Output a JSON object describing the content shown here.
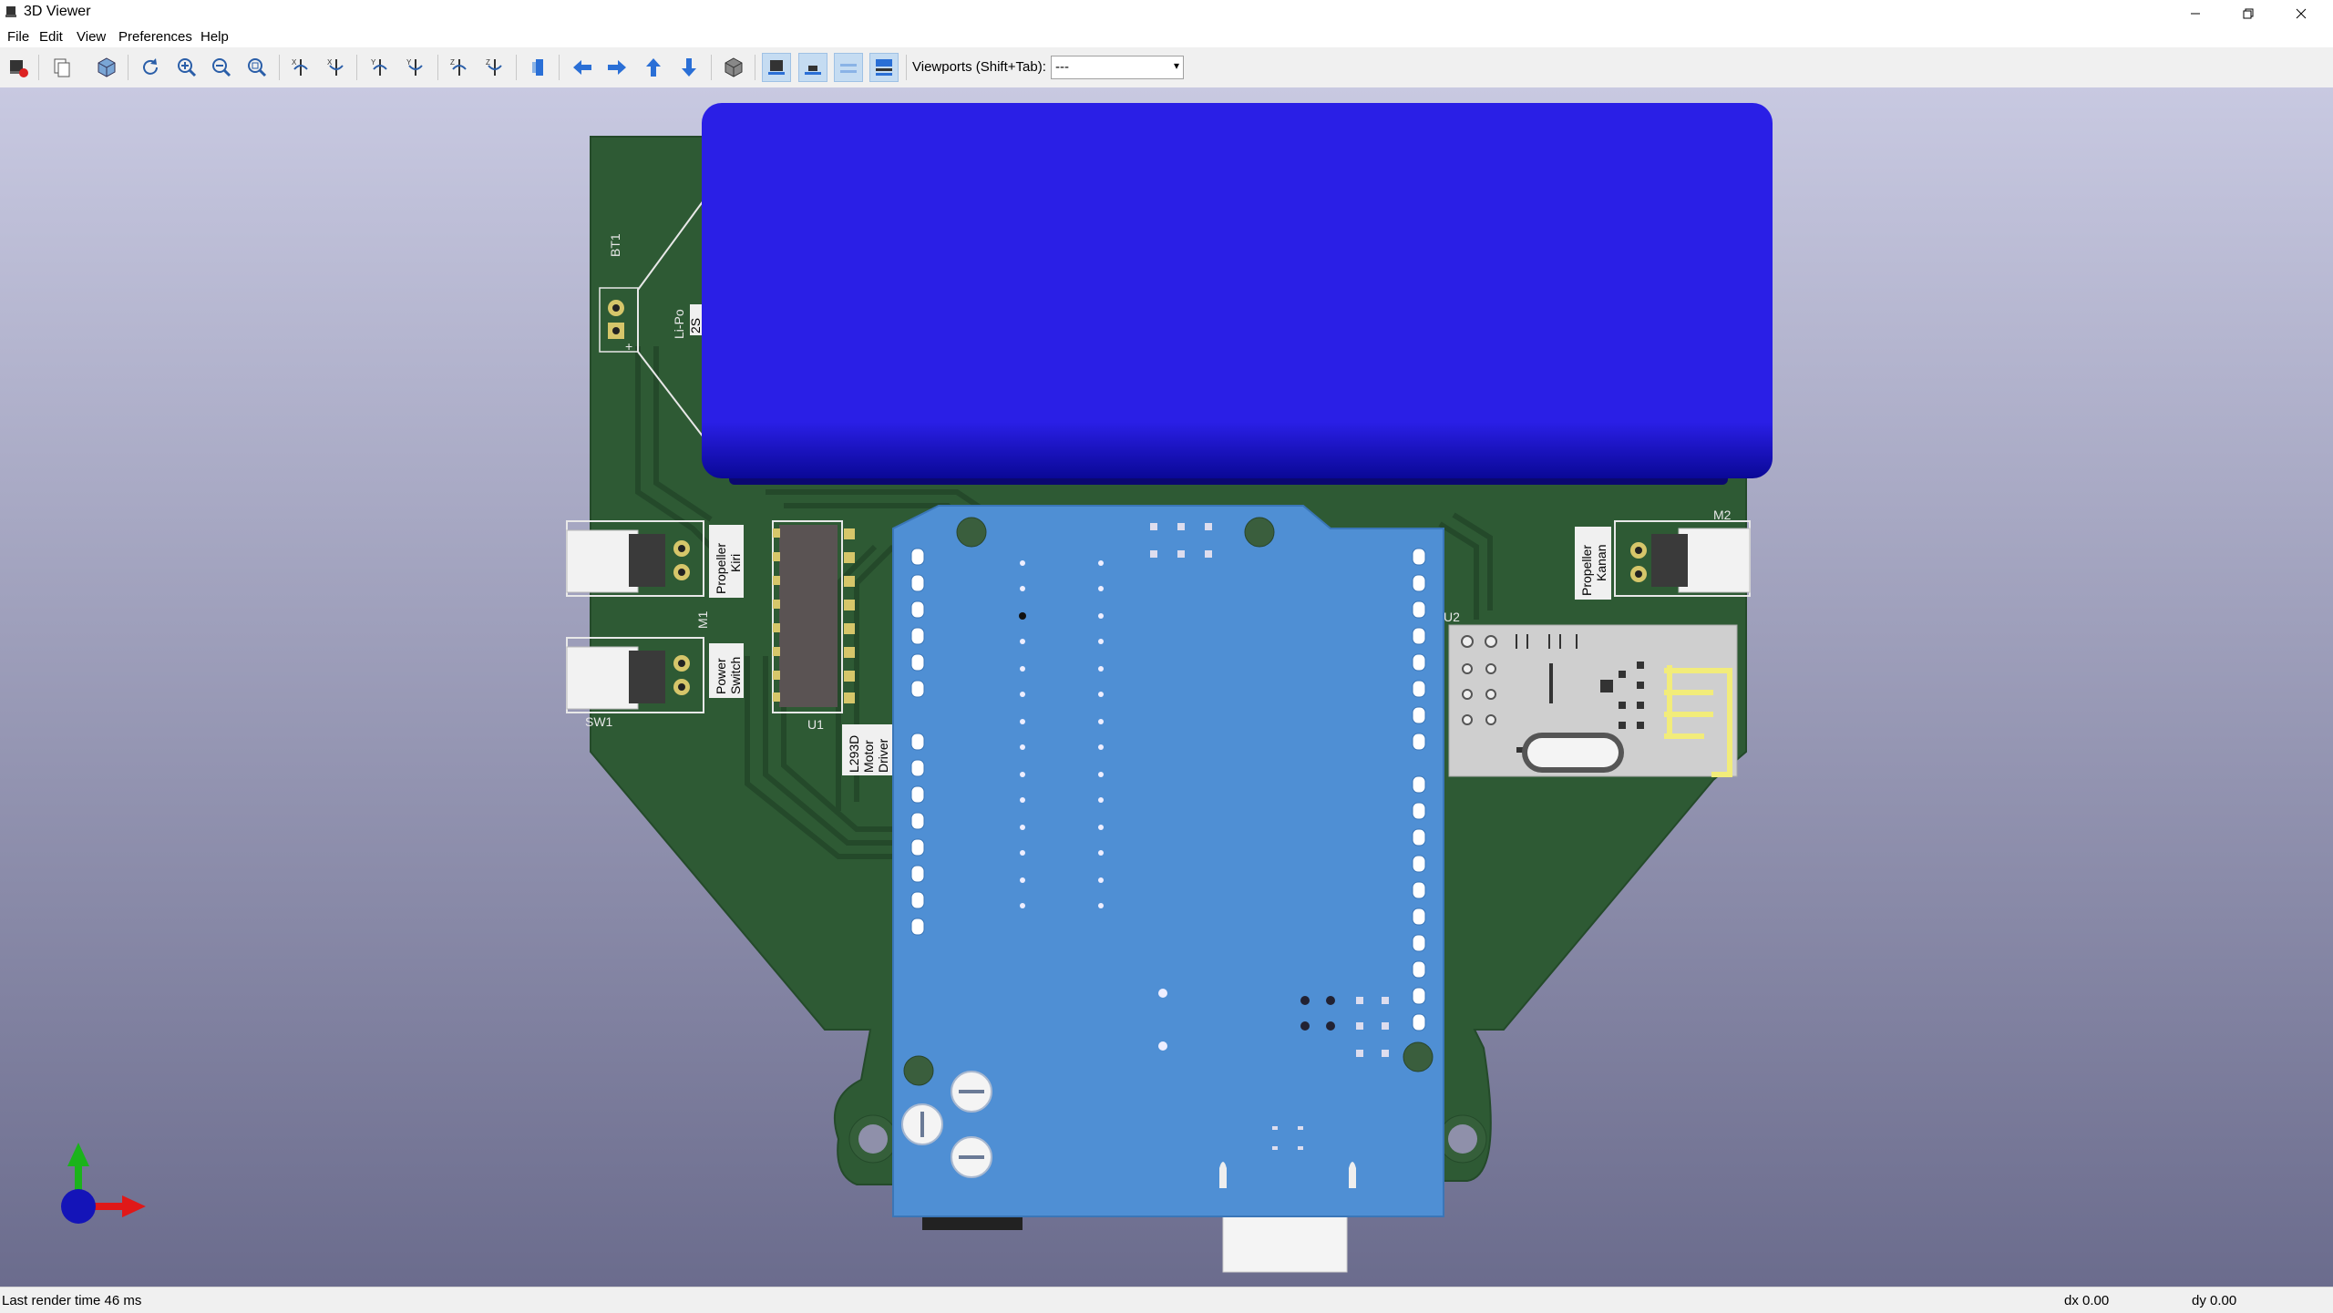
{
  "window": {
    "title": "3D Viewer"
  },
  "menu": [
    "File",
    "Edit",
    "View",
    "Preferences",
    "Help"
  ],
  "toolbar": {
    "viewports_label": "Viewports (Shift+Tab):",
    "viewports_value": "---"
  },
  "board": {
    "labels": {
      "bt1": "BT1",
      "lipo": "Li-Po",
      "lipo_2s": "2S",
      "m1": "M1",
      "m2": "M2",
      "sw1": "SW1",
      "u1": "U1",
      "u2": "U2",
      "prop_kiri_1": "Propeller",
      "prop_kiri_2": "Kiri",
      "power_1": "Power",
      "power_2": "Switch",
      "prop_kanan_1": "Propeller",
      "prop_kanan_2": "Kanan",
      "driver_1": "L293D",
      "driver_2": "Motor",
      "driver_3": "Driver",
      "plus": "+"
    },
    "colors": {
      "pcb": "#2e5a34",
      "battery": "#2a1fe6",
      "arduino": "#4f8fd4",
      "background_top": "#c8c9e1",
      "background_bottom": "#6b6c8d"
    }
  },
  "status": {
    "render_time": "Last render time 46 ms",
    "dx": "dx 0.00",
    "dy": "dy 0.00"
  }
}
